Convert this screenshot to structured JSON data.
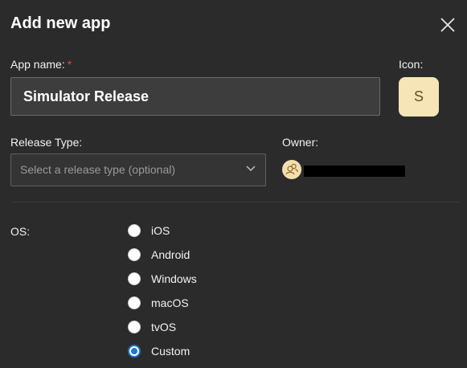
{
  "dialog": {
    "title": "Add new app",
    "close_icon": "close-icon"
  },
  "app_name": {
    "label": "App name:",
    "required_mark": "*",
    "value": "Simulator Release"
  },
  "icon": {
    "label": "Icon:",
    "letter": "S",
    "background": "#f6e5b6"
  },
  "release_type": {
    "label": "Release Type:",
    "placeholder": "Select a release type (optional)",
    "icon": "chevron-down-icon"
  },
  "owner": {
    "label": "Owner:",
    "avatar_icon": "people-icon",
    "name": "[redacted]"
  },
  "os": {
    "label": "OS:",
    "options": [
      {
        "label": "iOS",
        "checked": false
      },
      {
        "label": "Android",
        "checked": false
      },
      {
        "label": "Windows",
        "checked": false
      },
      {
        "label": "macOS",
        "checked": false
      },
      {
        "label": "tvOS",
        "checked": false
      },
      {
        "label": "Custom",
        "checked": true
      }
    ],
    "accent": "#1f78d1"
  }
}
